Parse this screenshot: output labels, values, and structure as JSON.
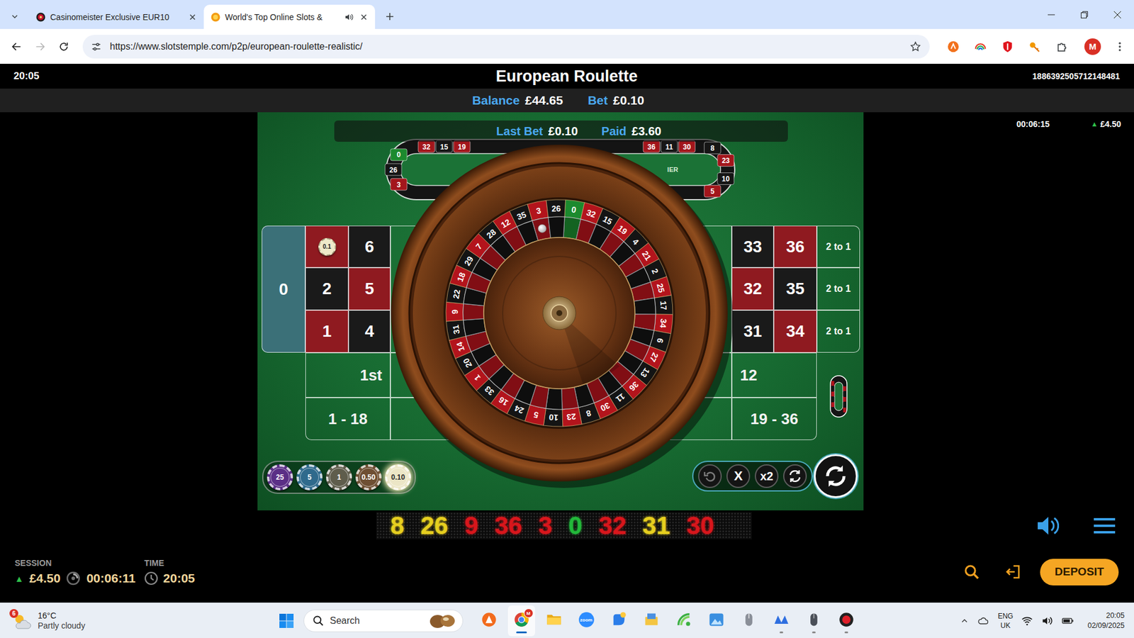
{
  "browser": {
    "tabs": [
      {
        "label": "Casinomeister Exclusive EUR10",
        "selected": false,
        "audio": false
      },
      {
        "label": "World's Top Online Slots &",
        "selected": true,
        "audio": true
      }
    ],
    "url": "https://www.slotstemple.com/p2p/european-roulette-realistic/",
    "profile": "M"
  },
  "game": {
    "clock": "20:05",
    "title": "European Roulette",
    "game_id": "1886392505712148481",
    "balance_label": "Balance",
    "balance": "£44.65",
    "bet_label": "Bet",
    "bet": "£0.10",
    "side_timer": "00:06:15",
    "side_trend": "▲",
    "side_delta": "£4.50",
    "last_bet_label": "Last Bet",
    "last_bet": "£0.10",
    "paid_label": "Paid",
    "paid": "£3.60",
    "racetrack": {
      "left_end": [
        {
          "number": "0",
          "color": "#1c8a2e"
        },
        {
          "number": "26",
          "color": "#161616"
        },
        {
          "number": "3",
          "color": "#a3161c"
        }
      ],
      "left_top": [
        {
          "number": "32",
          "color": "#a3161c"
        },
        {
          "number": "15",
          "color": "#161616"
        },
        {
          "number": "19",
          "color": "#a3161c"
        }
      ],
      "right_top": [
        {
          "number": "36",
          "color": "#a3161c"
        },
        {
          "number": "11",
          "color": "#161616"
        },
        {
          "number": "30",
          "color": "#a3161c"
        }
      ],
      "right_end": [
        {
          "number": "8",
          "color": "#161616"
        },
        {
          "number": "23",
          "color": "#a3161c"
        },
        {
          "number": "10",
          "color": "#161616"
        },
        {
          "number": "5",
          "color": "#a3161c"
        }
      ],
      "label": "IER"
    },
    "board": {
      "zero": {
        "number": "0",
        "color": "#3b7078"
      },
      "rows": [
        {
          "left": [
            {
              "chip": "0.1",
              "color": "#8f1a20"
            },
            {
              "number": "6",
              "color": "#1a1a1a"
            }
          ],
          "right": [
            {
              "number": "33",
              "color": "#1a1a1a"
            },
            {
              "number": "36",
              "color": "#8f1a20"
            }
          ],
          "column_bet": "2 to 1"
        },
        {
          "left": [
            {
              "number": "2",
              "color": "#1a1a1a"
            },
            {
              "number": "5",
              "color": "#8f1a20"
            }
          ],
          "right": [
            {
              "number": "32",
              "color": "#8f1a20"
            },
            {
              "number": "35",
              "color": "#1a1a1a"
            }
          ],
          "column_bet": "2 to 1"
        },
        {
          "left": [
            {
              "number": "1",
              "color": "#8f1a20"
            },
            {
              "number": "4",
              "color": "#1a1a1a"
            }
          ],
          "right": [
            {
              "number": "31",
              "color": "#1a1a1a"
            },
            {
              "number": "34",
              "color": "#8f1a20"
            }
          ],
          "column_bet": "2 to 1"
        }
      ],
      "dozen_left": "1st",
      "dozen_right": "12",
      "low": "1 - 18",
      "high": "19 - 36"
    },
    "wheel": {
      "pockets": [
        {
          "number": "0",
          "color": "#1c8a2e"
        },
        {
          "number": "32",
          "color": "#b3141c"
        },
        {
          "number": "15",
          "color": "#141414"
        },
        {
          "number": "19",
          "color": "#b3141c"
        },
        {
          "number": "4",
          "color": "#141414"
        },
        {
          "number": "21",
          "color": "#b3141c"
        },
        {
          "number": "2",
          "color": "#141414"
        },
        {
          "number": "25",
          "color": "#b3141c"
        },
        {
          "number": "17",
          "color": "#141414"
        },
        {
          "number": "34",
          "color": "#b3141c"
        },
        {
          "number": "6",
          "color": "#141414"
        },
        {
          "number": "27",
          "color": "#b3141c"
        },
        {
          "number": "13",
          "color": "#141414"
        },
        {
          "number": "36",
          "color": "#b3141c"
        },
        {
          "number": "11",
          "color": "#141414"
        },
        {
          "number": "30",
          "color": "#b3141c"
        },
        {
          "number": "8",
          "color": "#141414"
        },
        {
          "number": "23",
          "color": "#b3141c"
        },
        {
          "number": "10",
          "color": "#141414"
        },
        {
          "number": "5",
          "color": "#b3141c"
        },
        {
          "number": "24",
          "color": "#141414"
        },
        {
          "number": "16",
          "color": "#b3141c"
        },
        {
          "number": "33",
          "color": "#141414"
        },
        {
          "number": "1",
          "color": "#b3141c"
        },
        {
          "number": "20",
          "color": "#141414"
        },
        {
          "number": "14",
          "color": "#b3141c"
        },
        {
          "number": "31",
          "color": "#141414"
        },
        {
          "number": "9",
          "color": "#b3141c"
        },
        {
          "number": "22",
          "color": "#141414"
        },
        {
          "number": "18",
          "color": "#b3141c"
        },
        {
          "number": "29",
          "color": "#141414"
        },
        {
          "number": "7",
          "color": "#b3141c"
        },
        {
          "number": "28",
          "color": "#141414"
        },
        {
          "number": "12",
          "color": "#b3141c"
        },
        {
          "number": "35",
          "color": "#141414"
        },
        {
          "number": "3",
          "color": "#b3141c"
        },
        {
          "number": "26",
          "color": "#141414"
        }
      ],
      "ball_pocket": "3"
    },
    "chips": [
      {
        "value": "25",
        "color": "#5b2f86",
        "selected": false
      },
      {
        "value": "5",
        "color": "#2f6a8c",
        "selected": false
      },
      {
        "value": "1",
        "color": "#5f5d4c",
        "selected": false
      },
      {
        "value": "0.50",
        "color": "#6e4f33",
        "selected": false
      },
      {
        "value": "0.10",
        "color": "#ece6c6",
        "selected": true
      }
    ],
    "controls": [
      {
        "kind": "undo",
        "disabled": true
      },
      {
        "kind": "clear",
        "label": "X",
        "disabled": false
      },
      {
        "kind": "double",
        "label": "x2",
        "disabled": false
      },
      {
        "kind": "rebet",
        "disabled": false
      }
    ],
    "spin": {
      "disabled": false
    },
    "history": [
      {
        "number": "8",
        "color": "#e6cf1f"
      },
      {
        "number": "26",
        "color": "#e6cf1f"
      },
      {
        "number": "9",
        "color": "#d8161c"
      },
      {
        "number": "36",
        "color": "#d8161c"
      },
      {
        "number": "3",
        "color": "#d8161c"
      },
      {
        "number": "0",
        "color": "#22b83a"
      },
      {
        "number": "32",
        "color": "#d8161c"
      },
      {
        "number": "31",
        "color": "#e6cf1f"
      },
      {
        "number": "30",
        "color": "#d8161c"
      }
    ],
    "footer": {
      "session_label": "SESSION",
      "session_trend": "▲",
      "session_amount": "£4.50",
      "session_time": "00:06:11",
      "time_label": "TIME",
      "time": "20:05",
      "deposit": "DEPOSIT"
    }
  },
  "taskbar": {
    "weather": {
      "badge": "6",
      "temp": "16°C",
      "text": "Partly cloudy"
    },
    "search": "Search",
    "apps": [
      {
        "kind": "orange-app",
        "running": false,
        "active": false
      },
      {
        "kind": "chrome",
        "badge": "M",
        "running": true,
        "active": true
      },
      {
        "kind": "folder",
        "running": false,
        "active": false
      },
      {
        "kind": "zoom",
        "label": "zoom",
        "running": false,
        "active": false
      },
      {
        "kind": "blue-app",
        "running": false,
        "active": false
      },
      {
        "kind": "files",
        "running": false,
        "active": false
      },
      {
        "kind": "green-app",
        "running": false,
        "active": false
      },
      {
        "kind": "photos",
        "running": false,
        "active": false
      },
      {
        "kind": "mouse",
        "running": false,
        "active": false
      },
      {
        "kind": "wave",
        "running": true,
        "active": false
      },
      {
        "kind": "mouse-dark",
        "running": true,
        "active": false
      },
      {
        "kind": "recorder",
        "running": true,
        "active": false
      }
    ],
    "lang": "ENG",
    "region": "UK",
    "time": "20:05",
    "date": "02/09/2025"
  }
}
